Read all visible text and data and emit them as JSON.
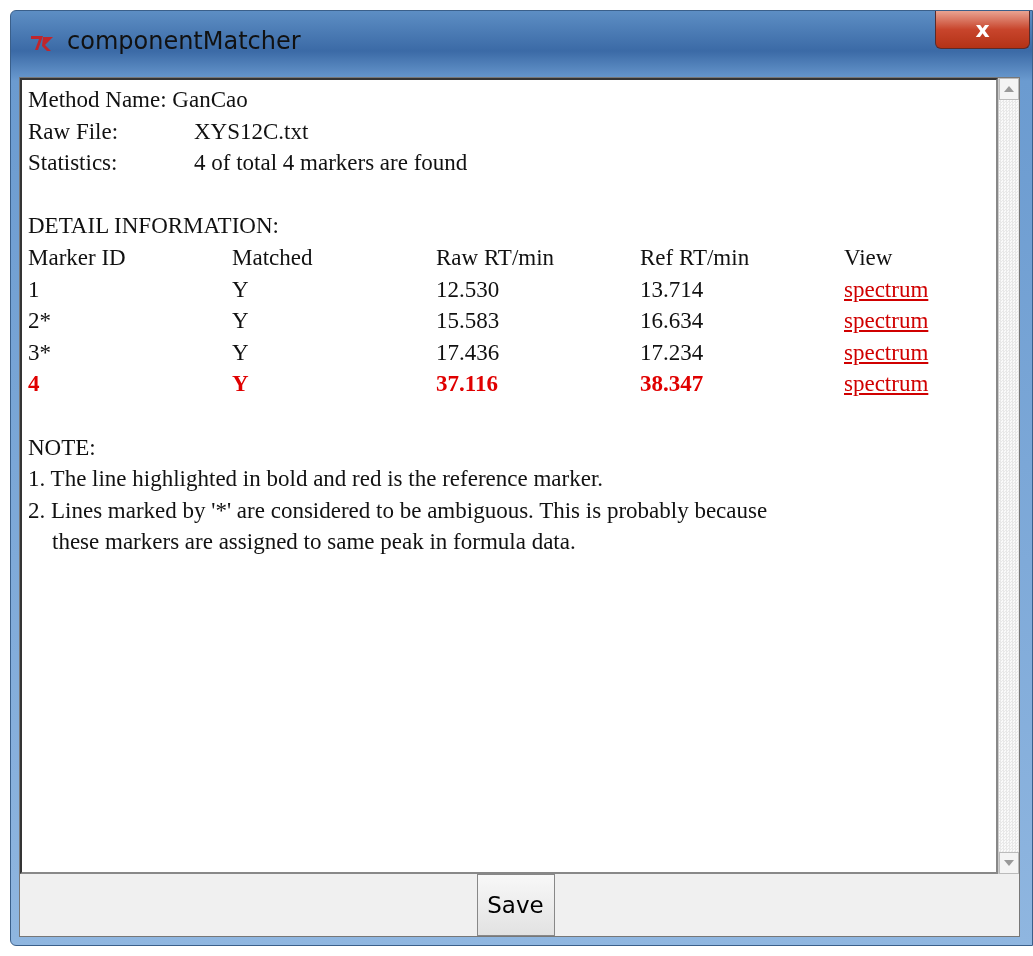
{
  "window": {
    "title": "componentMatcher",
    "close": "x"
  },
  "summary": [
    {
      "label": "Method Name:",
      "value": "GanCao",
      "kind": "inline"
    },
    {
      "label": "Raw File:",
      "value": "XYS12C.txt",
      "kind": "tab"
    },
    {
      "label": "Statistics:",
      "value": "4 of total 4 markers are found",
      "kind": "tab"
    }
  ],
  "detail": {
    "heading": "DETAIL INFORMATION:",
    "columns": [
      "Marker ID",
      "Matched",
      "Raw RT/min",
      "Ref RT/min",
      "View"
    ],
    "rows": [
      {
        "cells": [
          "1",
          "Y",
          "12.530",
          "13.714"
        ],
        "link": "spectrum",
        "reference": false
      },
      {
        "cells": [
          "2*",
          "Y",
          "15.583",
          "16.634"
        ],
        "link": "spectrum",
        "reference": false
      },
      {
        "cells": [
          "3*",
          "Y",
          "17.436",
          "17.234"
        ],
        "link": "spectrum",
        "reference": false
      },
      {
        "cells": [
          "4",
          "Y",
          "37.116",
          "38.347"
        ],
        "link": "spectrum",
        "reference": true
      }
    ]
  },
  "note": {
    "heading": "NOTE:",
    "items": [
      {
        "lines": [
          "1. The line highlighted in bold and red is the reference marker."
        ]
      },
      {
        "lines": [
          "2. Lines marked by '*' are considered to be ambiguous. This is probably because",
          "these markers are assigned to same peak in formula data."
        ]
      }
    ]
  },
  "buttons": [
    "Save"
  ]
}
